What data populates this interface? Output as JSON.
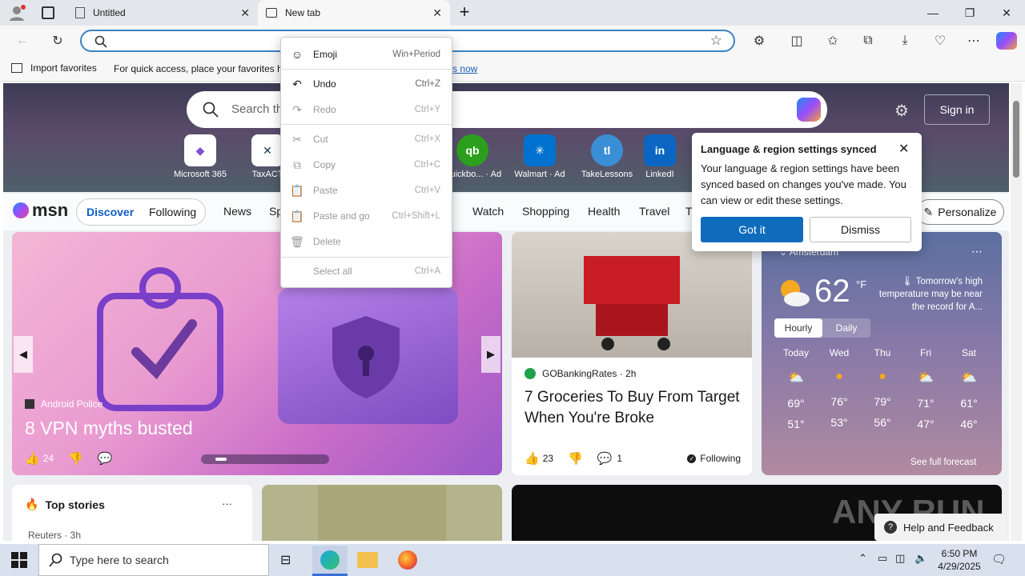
{
  "browser": {
    "tabs": [
      {
        "label": "Untitled",
        "close": "✕"
      },
      {
        "label": "New tab",
        "close": "✕"
      }
    ],
    "new_tab": "+",
    "window_controls": {
      "minimize": "—",
      "restore": "❐",
      "close": "✕"
    },
    "favorites_bar": {
      "import": "Import favorites",
      "hint": "For quick access, place your favorites he",
      "link_tail": "s now"
    }
  },
  "context_menu": {
    "items": [
      {
        "label": "Emoji",
        "shortcut": "Win+Period",
        "icon": "☺"
      },
      {
        "label": "Undo",
        "shortcut": "Ctrl+Z",
        "icon": "↶"
      },
      {
        "label": "Redo",
        "shortcut": "Ctrl+Y",
        "icon": "↷"
      },
      {
        "label": "Cut",
        "shortcut": "Ctrl+X",
        "icon": "✂"
      },
      {
        "label": "Copy",
        "shortcut": "Ctrl+C",
        "icon": "⧉"
      },
      {
        "label": "Paste",
        "shortcut": "Ctrl+V",
        "icon": "📋"
      },
      {
        "label": "Paste and go",
        "shortcut": "Ctrl+Shift+L",
        "icon": "📋"
      },
      {
        "label": "Delete",
        "shortcut": "",
        "icon": "🗑"
      },
      {
        "label": "Select all",
        "shortcut": "Ctrl+A",
        "icon": ""
      }
    ]
  },
  "msn": {
    "search_placeholder": "Search th",
    "sign_in": "Sign in",
    "quicklinks": [
      {
        "label": "Microsoft 365",
        "glyph": "◆"
      },
      {
        "label": "TaxACT",
        "glyph": "✕"
      },
      {
        "label": "Quickbo... · Ad",
        "glyph": "qb"
      },
      {
        "label": "Walmart · Ad",
        "glyph": "✳"
      },
      {
        "label": "TakeLessons",
        "glyph": "tl"
      },
      {
        "label": "LinkedI",
        "glyph": "in"
      }
    ],
    "logo": "msn",
    "nav": {
      "discover": "Discover",
      "following": "Following",
      "items": [
        "News",
        "Sp",
        "Watch",
        "Shopping",
        "Health",
        "Travel",
        "T"
      ],
      "personalize": "Personalize"
    }
  },
  "popup": {
    "title": "Language & region settings synced",
    "body": "Your language & region settings have been synced based on changes you've made. You can view or edit these settings.",
    "got_it": "Got it",
    "dismiss": "Dismiss"
  },
  "hero_card": {
    "source": "Android Police",
    "title": "8 VPN myths busted",
    "likes": "24"
  },
  "news_card": {
    "source": "GOBankingRates · 2h",
    "title": "7 Groceries To Buy From Target When You're Broke",
    "likes": "23",
    "comments": "1",
    "following": "Following"
  },
  "weather": {
    "location": "Amsterdam",
    "temp": "62",
    "unit": "°F",
    "alert": "Tomorrow's high temperature may be near the record for A...",
    "tabs": {
      "hourly": "Hourly",
      "daily": "Daily"
    },
    "days": [
      {
        "day": "Today",
        "high": "69°",
        "low": "51°"
      },
      {
        "day": "Wed",
        "high": "76°",
        "low": "53°"
      },
      {
        "day": "Thu",
        "high": "79°",
        "low": "56°"
      },
      {
        "day": "Fri",
        "high": "71°",
        "low": "47°"
      },
      {
        "day": "Sat",
        "high": "61°",
        "low": "46°"
      }
    ],
    "see_full": "See full forecast"
  },
  "top_stories": {
    "title": "Top stories",
    "more": "···",
    "first_source": "Reuters · 3h"
  },
  "help_feedback": "Help and Feedback",
  "watermark": "ANY RUN",
  "taskbar": {
    "search_placeholder": "Type here to search",
    "time": "6:50 PM",
    "date": "4/29/2025"
  }
}
